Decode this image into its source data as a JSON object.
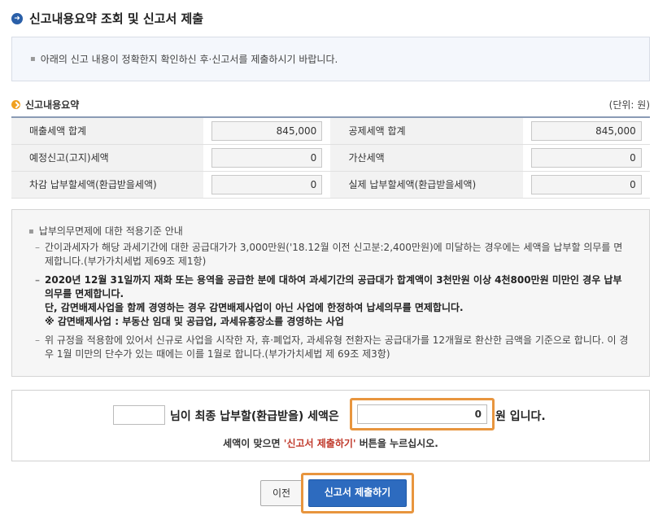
{
  "page": {
    "title": "신고내용요약 조회 및 신고서 제출",
    "title_icon": "arrow-right-circle-icon"
  },
  "notice": {
    "text": "아래의 신고 내용이 정확한지 확인하신 후·신고서를 제출하시기 바랍니다."
  },
  "summary": {
    "title": "신고내용요약",
    "unit": "(단위: 원)",
    "rows": [
      [
        {
          "label": "매출세액 합계",
          "value": "845,000"
        },
        {
          "label": "공제세액 합계",
          "value": "845,000"
        }
      ],
      [
        {
          "label": "예정신고(고지)세액",
          "value": "0"
        },
        {
          "label": "가산세액",
          "value": "0"
        }
      ],
      [
        {
          "label": "차감 납부할세액(환급받을세액)",
          "value": "0"
        },
        {
          "label": "실제 납부할세액(환급받을세액)",
          "value": "0"
        }
      ]
    ]
  },
  "info": {
    "heading": "납부의무면제에 대한 적용기준 안내",
    "items": [
      {
        "text": "간이과세자가 해당 과세기간에 대한 공급대가가 3,000만원('18.12월 이전 신고분:2,400만원)에 미달하는 경우에는 세액을 납부할 의무를 면제합니다.(부가가치세법 제69조 제1항)",
        "bold": false
      },
      {
        "text": "2020년 12월 31일까지 재화 또는 용역을 공급한 분에 대하여 과세기간의 공급대가 합계액이 3천만원 이상 4천800만원 미만인 경우 납부의무를 면제합니다.",
        "bold": true
      },
      {
        "text": "단, 감면배제사업을 함께 경영하는 경우 감면배제사업이 아닌 사업에 한정하여 납세의무를 면제합니다.",
        "bold": true
      },
      {
        "text": "※ 감면배제사업 : 부동산 임대 및 공급업, 과세유흥장소를 경영하는 사업",
        "bold": true
      },
      {
        "text": "위 규정을 적용함에 있어서 신규로 사업을 시작한 자, 휴·폐업자, 과세유형 전환자는 공급대가를 12개월로 환산한 금액을 기준으로 합니다. 이 경우 1월 미만의 단수가 있는 때에는 이를 1월로 합니다.(부가가치세법 제 69조 제3항)",
        "bold": false
      }
    ]
  },
  "final": {
    "name_value": "",
    "text_before": "님이 최종 납부할(환급받을) 세액은",
    "amount": "0",
    "text_after": "원 입니다.",
    "confirm_prefix": "세액이 맞으면 ",
    "confirm_highlight": "'신고서 제출하기'",
    "confirm_suffix": " 버튼을 누르십시오."
  },
  "buttons": {
    "prev": "이전",
    "submit": "신고서 제출하기"
  },
  "colors": {
    "accent": "#2d6bbf",
    "highlight": "#e8953e",
    "emphasis": "#c0392b"
  }
}
